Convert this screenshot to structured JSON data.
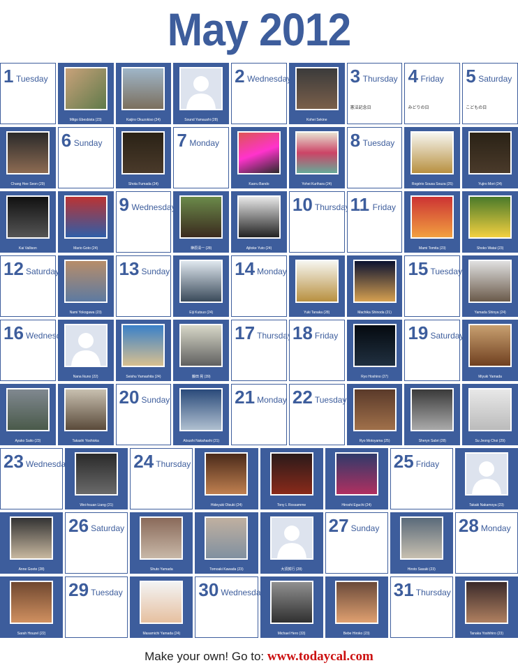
{
  "title": "May 2012",
  "rows": [
    [
      {
        "kind": "day",
        "num": "1",
        "dname": "Tuesday",
        "note": ""
      },
      {
        "kind": "photo",
        "cap": "Mitgo Ebesbista (23)",
        "cls": "p1"
      },
      {
        "kind": "photo",
        "cap": "Kaijiro Okuzokiso (24)",
        "cls": "p2"
      },
      {
        "kind": "photo",
        "cap": "Sound Yamaushi (28)",
        "cls": "anon"
      },
      {
        "kind": "day",
        "num": "2",
        "dname": "Wednesday",
        "note": ""
      },
      {
        "kind": "photo",
        "cap": "Kohei Sekine",
        "cls": "p3"
      },
      {
        "kind": "day",
        "num": "3",
        "dname": "Thursday",
        "note": "憲法記念日"
      },
      {
        "kind": "day",
        "num": "4",
        "dname": "Friday",
        "note": "みどりの日"
      },
      {
        "kind": "day",
        "num": "5",
        "dname": "Saturday",
        "note": "こどもの日"
      }
    ],
    [
      {
        "kind": "photo",
        "cap": "Chang Hee Seon (29)",
        "cls": "p4"
      },
      {
        "kind": "day",
        "num": "6",
        "dname": "Sunday",
        "note": ""
      },
      {
        "kind": "photo",
        "cap": "Shota Fumada (24)",
        "cls": "p7"
      },
      {
        "kind": "day",
        "num": "7",
        "dname": "Monday",
        "note": ""
      },
      {
        "kind": "photo",
        "cap": "Kaoru Bando",
        "cls": "p5"
      },
      {
        "kind": "photo",
        "cap": "Yohei Kurihara (24)",
        "cls": "p6"
      },
      {
        "kind": "day",
        "num": "8",
        "dname": "Tuesday",
        "note": ""
      },
      {
        "kind": "photo",
        "cap": "Rogério Sousa Souza (25)",
        "cls": "p16"
      },
      {
        "kind": "photo",
        "cap": "Yujiro Mori (24)",
        "cls": "p7"
      }
    ],
    [
      {
        "kind": "photo",
        "cap": "Kai Vallison",
        "cls": "p8"
      },
      {
        "kind": "photo",
        "cap": "Mario Goto (24)",
        "cls": "p9"
      },
      {
        "kind": "day",
        "num": "9",
        "dname": "Wednesday",
        "note": ""
      },
      {
        "kind": "photo",
        "cap": "榊原清一 (28)",
        "cls": "p10"
      },
      {
        "kind": "photo",
        "cap": "Ajitoke Yuto (24)",
        "cls": "p11"
      },
      {
        "kind": "day",
        "num": "10",
        "dname": "Thursday",
        "note": ""
      },
      {
        "kind": "day",
        "num": "11",
        "dname": "Friday",
        "note": ""
      },
      {
        "kind": "photo",
        "cap": "Mami Tomita (23)",
        "cls": "p12"
      },
      {
        "kind": "photo",
        "cap": "Shoko Watai (23)",
        "cls": "p13"
      }
    ],
    [
      {
        "kind": "day",
        "num": "12",
        "dname": "Saturday",
        "note": ""
      },
      {
        "kind": "photo",
        "cap": "Nami Yokogawa (23)",
        "cls": "p14"
      },
      {
        "kind": "day",
        "num": "13",
        "dname": "Sunday",
        "note": ""
      },
      {
        "kind": "photo",
        "cap": "Eiji Kutsuo (24)",
        "cls": "p15"
      },
      {
        "kind": "day",
        "num": "14",
        "dname": "Monday",
        "note": ""
      },
      {
        "kind": "photo",
        "cap": "Yuki Tanaka (28)",
        "cls": "p16"
      },
      {
        "kind": "photo",
        "cap": "Machika Shinoda (21)",
        "cls": "p17"
      },
      {
        "kind": "day",
        "num": "15",
        "dname": "Tuesday",
        "note": ""
      },
      {
        "kind": "photo",
        "cap": "Yamada Shinya (24)",
        "cls": "p18"
      }
    ],
    [
      {
        "kind": "day",
        "num": "16",
        "dname": "Wednesday",
        "note": ""
      },
      {
        "kind": "photo",
        "cap": "Nana Ikuno (22)",
        "cls": "anon"
      },
      {
        "kind": "photo",
        "cap": "Seishu Yamashita (24)",
        "cls": "p19"
      },
      {
        "kind": "photo",
        "cap": "藤田 晃 (39)",
        "cls": "p20"
      },
      {
        "kind": "day",
        "num": "17",
        "dname": "Thursday",
        "note": ""
      },
      {
        "kind": "day",
        "num": "18",
        "dname": "Friday",
        "note": ""
      },
      {
        "kind": "photo",
        "cap": "Ryo Hoshino (27)",
        "cls": "p21"
      },
      {
        "kind": "day",
        "num": "19",
        "dname": "Saturday",
        "note": ""
      },
      {
        "kind": "photo",
        "cap": "Miyuki Yamada",
        "cls": "p22"
      }
    ],
    [
      {
        "kind": "photo",
        "cap": "Ayako Saito (23)",
        "cls": "p23"
      },
      {
        "kind": "photo",
        "cap": "Takashi Yoshioka",
        "cls": "p24"
      },
      {
        "kind": "day",
        "num": "20",
        "dname": "Sunday",
        "note": ""
      },
      {
        "kind": "photo",
        "cap": "Atsushi Nakahashi (21)",
        "cls": "p25"
      },
      {
        "kind": "day",
        "num": "21",
        "dname": "Monday",
        "note": ""
      },
      {
        "kind": "day",
        "num": "22",
        "dname": "Tuesday",
        "note": ""
      },
      {
        "kind": "photo",
        "cap": "Ryo Motoyama (25)",
        "cls": "p26"
      },
      {
        "kind": "photo",
        "cap": "Sheryn Sabri (28)",
        "cls": "p27"
      },
      {
        "kind": "photo",
        "cap": "Su Jeong Choi (29)",
        "cls": "p35"
      }
    ],
    [
      {
        "kind": "day",
        "num": "23",
        "dname": "Wednesday",
        "note": ""
      },
      {
        "kind": "photo",
        "cap": "Wei-hsuan Liang (21)",
        "cls": "p28"
      },
      {
        "kind": "day",
        "num": "24",
        "dname": "Thursday",
        "note": ""
      },
      {
        "kind": "photo",
        "cap": "Hideyuki Otsuki (24)",
        "cls": "p29"
      },
      {
        "kind": "photo",
        "cap": "Tony L Rossamme",
        "cls": "p30"
      },
      {
        "kind": "photo",
        "cap": "Hiroshi Eguchi (24)",
        "cls": "p31"
      },
      {
        "kind": "day",
        "num": "25",
        "dname": "Friday",
        "note": ""
      },
      {
        "kind": "photo",
        "cap": "Takaki Nakamoya (23)",
        "cls": "anon"
      }
    ],
    [
      {
        "kind": "photo",
        "cap": "Anne Goete (28)",
        "cls": "p32"
      },
      {
        "kind": "day",
        "num": "26",
        "dname": "Saturday",
        "note": ""
      },
      {
        "kind": "photo",
        "cap": "Shuto Yamada",
        "cls": "p33"
      },
      {
        "kind": "photo",
        "cap": "Tomoaki Kawada (23)",
        "cls": "p34"
      },
      {
        "kind": "photo",
        "cap": "大須賀行 (28)",
        "cls": "anon"
      },
      {
        "kind": "day",
        "num": "27",
        "dname": "Sunday",
        "note": ""
      },
      {
        "kind": "photo",
        "cap": "Hiroto Sasaki (23)",
        "cls": "p36"
      },
      {
        "kind": "day",
        "num": "28",
        "dname": "Monday",
        "note": ""
      }
    ],
    [
      {
        "kind": "photo",
        "cap": "Sarah Houzel (22)",
        "cls": "p37"
      },
      {
        "kind": "day",
        "num": "29",
        "dname": "Tuesday",
        "note": ""
      },
      {
        "kind": "photo",
        "cap": "Masamichi Yamada (24)",
        "cls": "p38"
      },
      {
        "kind": "day",
        "num": "30",
        "dname": "Wednesday",
        "note": ""
      },
      {
        "kind": "photo",
        "cap": "Michael Hero (33)",
        "cls": "p39"
      },
      {
        "kind": "photo",
        "cap": "Bebe Hiroko (23)",
        "cls": "p40"
      },
      {
        "kind": "day",
        "num": "31",
        "dname": "Thursday",
        "note": ""
      },
      {
        "kind": "photo",
        "cap": "Tanaka Yoshihiro (23)",
        "cls": "p41"
      }
    ]
  ],
  "footer": {
    "text": "Make your own! Go to:",
    "url": "www.todaycal.com"
  }
}
